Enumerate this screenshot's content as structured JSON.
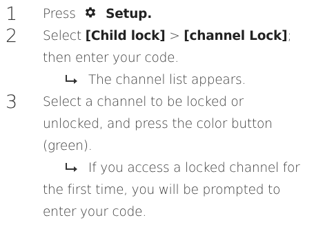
{
  "steps": [
    {
      "number": "1",
      "press": "Press",
      "icon": "gear-icon",
      "setup": "Setup."
    },
    {
      "number": "2",
      "select": "Select",
      "child_lock": "[Child lock]",
      "sep": ">",
      "channel_lock": "[channel Lock]",
      "semicolon": ";",
      "line2": "then enter your code.",
      "result_icon": "result-arrow-icon",
      "result": "The channel list appears."
    },
    {
      "number": "3",
      "line1": "Select a channel to be locked or",
      "line2": "unlocked, and press the color button",
      "line3": "(green).",
      "result_icon": "result-arrow-icon",
      "result_line1": "If you access a locked channel for",
      "result_line2": "the first time, you will be prompted to",
      "result_line3": "enter your code."
    }
  ]
}
